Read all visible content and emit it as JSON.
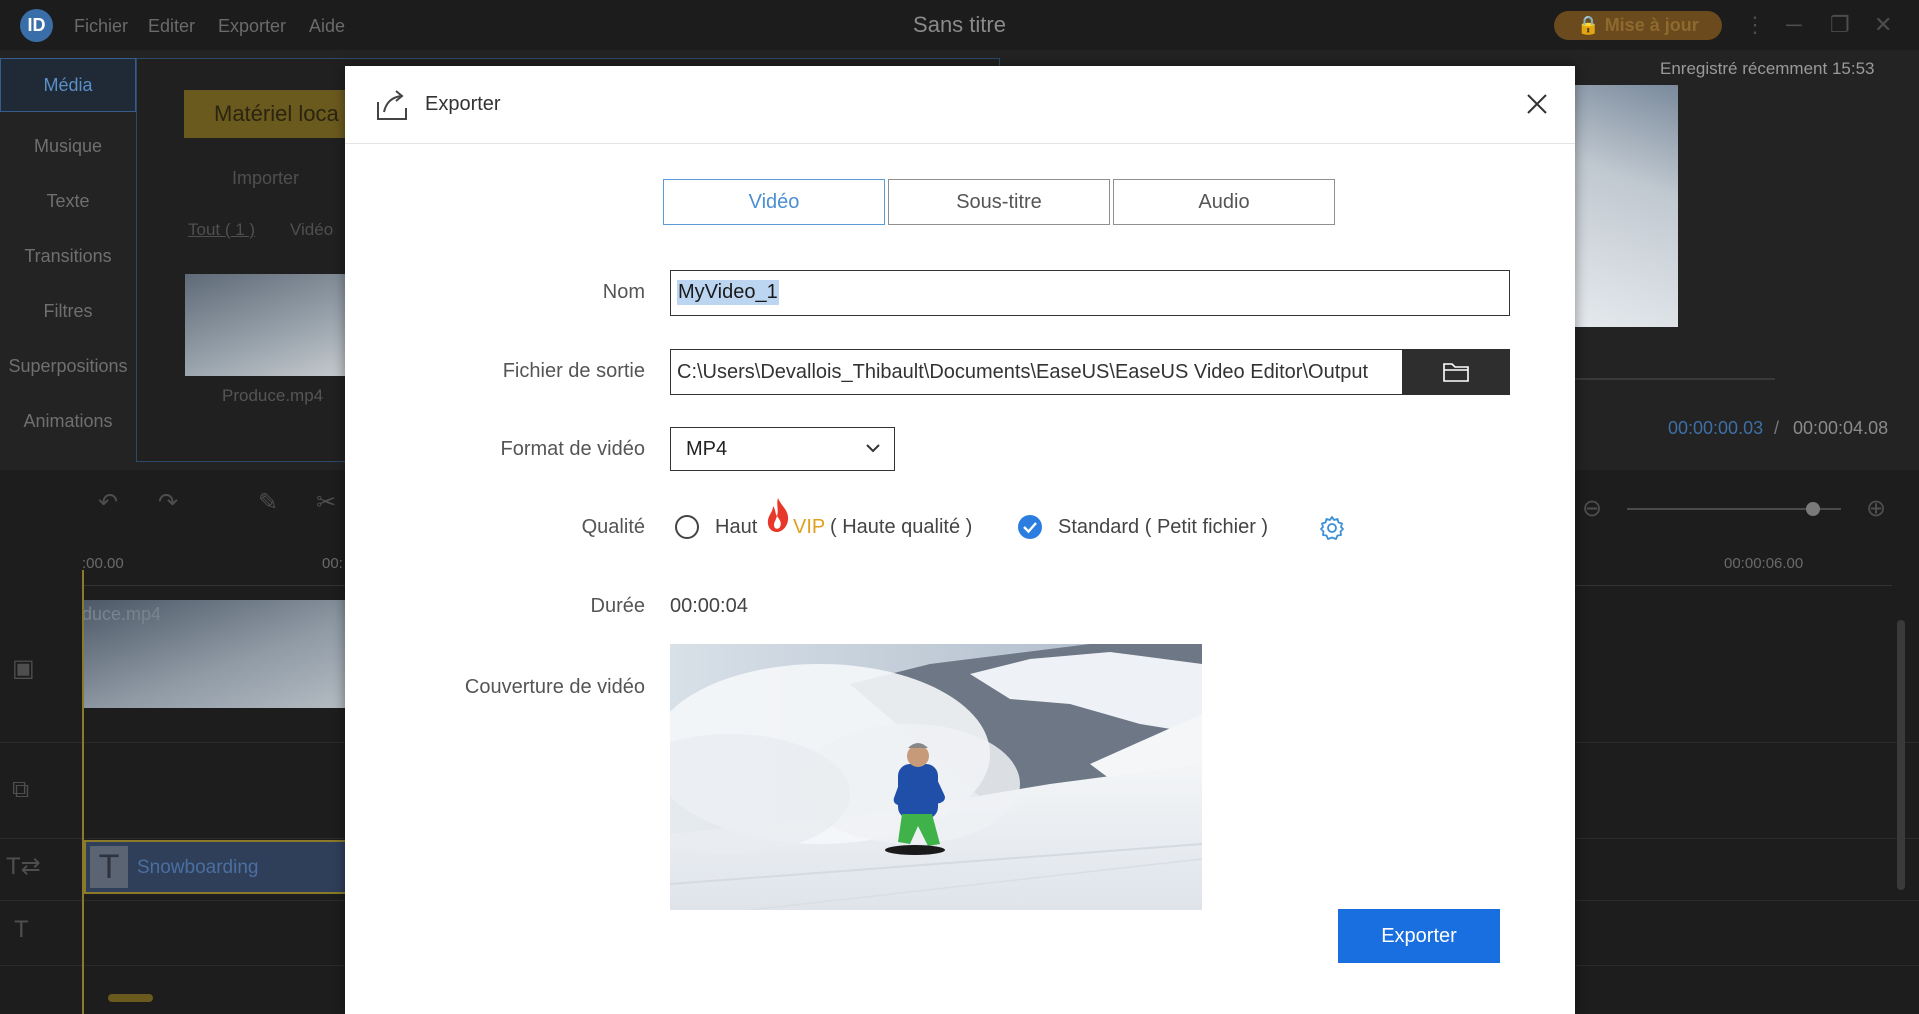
{
  "app": {
    "logo_text": "ID",
    "title": "Sans titre",
    "menu": [
      "Fichier",
      "Editer",
      "Exporter",
      "Aide"
    ],
    "upgrade_label": "Mise à jour"
  },
  "sidebar": {
    "items": [
      {
        "label": "Média"
      },
      {
        "label": "Musique"
      },
      {
        "label": "Texte"
      },
      {
        "label": "Transitions"
      },
      {
        "label": "Filtres"
      },
      {
        "label": "Superpositions"
      },
      {
        "label": "Animations"
      }
    ]
  },
  "media": {
    "local_tab": "Matériel loca",
    "import_label": "Importer",
    "filter_all": "Tout ( 1 )",
    "filter_video": "Vidéo",
    "item_name": "Produce.mp4"
  },
  "preview": {
    "saved": "Enregistré récemment 15:53",
    "current_time": "00:00:00.03",
    "separator": "/",
    "total_time": "00:00:04.08"
  },
  "timeline": {
    "ruler_start": ":00.00",
    "ruler_mid": "00:",
    "ruler_end": "00:00:06.00",
    "video_clip_label": "duce.mp4",
    "text_clip_label": "Snowboarding",
    "text_clip_icon": "T"
  },
  "dialog": {
    "title": "Exporter",
    "tabs": [
      {
        "label": "Vidéo",
        "active": true
      },
      {
        "label": "Sous-titre",
        "active": false
      },
      {
        "label": "Audio",
        "active": false
      }
    ],
    "labels": {
      "name": "Nom",
      "output": "Fichier de sortie",
      "format": "Format de vidéo",
      "quality": "Qualité",
      "duration": "Durée",
      "cover": "Couverture de vidéo"
    },
    "name_value": "MyVideo_1",
    "output_value": "C:\\Users\\Devallois_Thibault\\Documents\\EaseUS\\EaseUS Video Editor\\Output",
    "format_value": "MP4",
    "quality": {
      "high_label": "Haut",
      "vip_label": "VIP",
      "high_desc": "( Haute qualité )",
      "standard_label": "Standard ( Petit fichier )",
      "selected": "standard"
    },
    "duration_value": "00:00:04",
    "export_label": "Exporter"
  },
  "colors": {
    "accent": "#1a6fe0",
    "tab_active": "#4a8fd3",
    "vip": "#e0a020",
    "flame": "#e8382a"
  }
}
